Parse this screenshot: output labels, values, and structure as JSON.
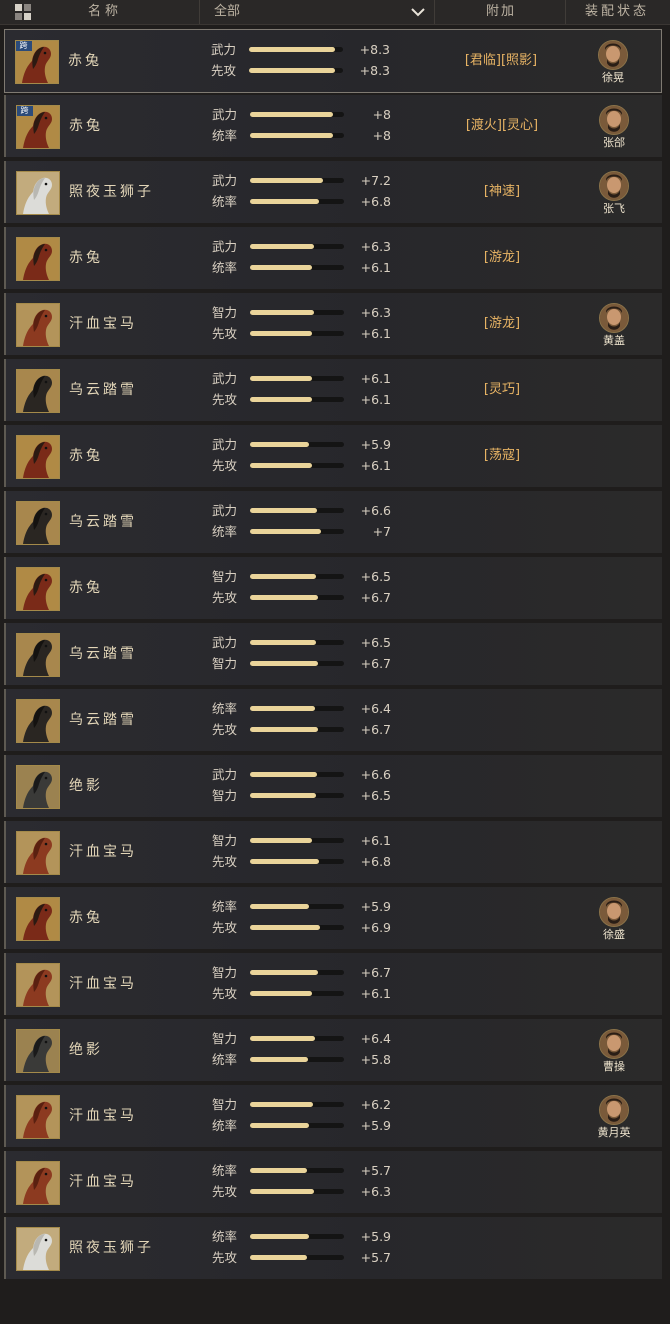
{
  "header": {
    "name_col": "名称",
    "filter_value": "全部",
    "extra_col": "附加",
    "status_col": "装配状态",
    "layout_icon": "grid-layout-icon",
    "filter_icon": "chevron-down-icon"
  },
  "colors": {
    "bar_fill": "#ead49a",
    "bar_track": "#141414",
    "extra_text": "#e7b364",
    "row_bg": "#2b2b30"
  },
  "horses": [
    {
      "name": "赤兔",
      "portrait": "red-horse-icon",
      "cross_server": true,
      "cross_label": "跨",
      "selected": true,
      "stats": [
        {
          "label": "武力",
          "value": "+8.3",
          "bar": 0.92
        },
        {
          "label": "先攻",
          "value": "+8.3",
          "bar": 0.92
        }
      ],
      "extra": "[君临][照影]",
      "equipped_by": "徐晃",
      "avatar": "general-avatar-icon"
    },
    {
      "name": "赤兔",
      "portrait": "red-horse-icon",
      "cross_server": true,
      "cross_label": "跨",
      "selected": false,
      "stats": [
        {
          "label": "武力",
          "value": "+8",
          "bar": 0.88
        },
        {
          "label": "统率",
          "value": "+8",
          "bar": 0.88
        }
      ],
      "extra": "[渡火][灵心]",
      "equipped_by": "张郃",
      "avatar": "general-avatar-icon"
    },
    {
      "name": "照夜玉狮子",
      "portrait": "white-horse-icon",
      "cross_server": false,
      "selected": false,
      "stats": [
        {
          "label": "武力",
          "value": "+7.2",
          "bar": 0.78
        },
        {
          "label": "统率",
          "value": "+6.8",
          "bar": 0.73
        }
      ],
      "extra": "[神速]",
      "equipped_by": "张飞",
      "avatar": "general-avatar-icon"
    },
    {
      "name": "赤兔",
      "portrait": "red-horse-icon",
      "cross_server": false,
      "selected": false,
      "stats": [
        {
          "label": "武力",
          "value": "+6.3",
          "bar": 0.68
        },
        {
          "label": "统率",
          "value": "+6.1",
          "bar": 0.66
        }
      ],
      "extra": "[游龙]",
      "equipped_by": "",
      "avatar": ""
    },
    {
      "name": "汗血宝马",
      "portrait": "chestnut-horse-icon",
      "cross_server": false,
      "selected": false,
      "stats": [
        {
          "label": "智力",
          "value": "+6.3",
          "bar": 0.68
        },
        {
          "label": "先攻",
          "value": "+6.1",
          "bar": 0.66
        }
      ],
      "extra": "[游龙]",
      "equipped_by": "黄盖",
      "avatar": "general-avatar-icon"
    },
    {
      "name": "乌云踏雪",
      "portrait": "black-horse-icon",
      "cross_server": false,
      "selected": false,
      "stats": [
        {
          "label": "武力",
          "value": "+6.1",
          "bar": 0.66
        },
        {
          "label": "先攻",
          "value": "+6.1",
          "bar": 0.66
        }
      ],
      "extra": "[灵巧]",
      "equipped_by": "",
      "avatar": ""
    },
    {
      "name": "赤兔",
      "portrait": "red-horse-icon",
      "cross_server": false,
      "selected": false,
      "stats": [
        {
          "label": "武力",
          "value": "+5.9",
          "bar": 0.63
        },
        {
          "label": "先攻",
          "value": "+6.1",
          "bar": 0.66
        }
      ],
      "extra": "[荡寇]",
      "equipped_by": "",
      "avatar": ""
    },
    {
      "name": "乌云踏雪",
      "portrait": "black-horse-icon",
      "cross_server": false,
      "selected": false,
      "stats": [
        {
          "label": "武力",
          "value": "+6.6",
          "bar": 0.71
        },
        {
          "label": "统率",
          "value": "+7",
          "bar": 0.75
        }
      ],
      "extra": "",
      "equipped_by": "",
      "avatar": ""
    },
    {
      "name": "赤兔",
      "portrait": "red-horse-icon",
      "cross_server": false,
      "selected": false,
      "stats": [
        {
          "label": "智力",
          "value": "+6.5",
          "bar": 0.7
        },
        {
          "label": "先攻",
          "value": "+6.7",
          "bar": 0.72
        }
      ],
      "extra": "",
      "equipped_by": "",
      "avatar": ""
    },
    {
      "name": "乌云踏雪",
      "portrait": "black-horse-icon",
      "cross_server": false,
      "selected": false,
      "stats": [
        {
          "label": "武力",
          "value": "+6.5",
          "bar": 0.7
        },
        {
          "label": "智力",
          "value": "+6.7",
          "bar": 0.72
        }
      ],
      "extra": "",
      "equipped_by": "",
      "avatar": ""
    },
    {
      "name": "乌云踏雪",
      "portrait": "black-horse-icon",
      "cross_server": false,
      "selected": false,
      "stats": [
        {
          "label": "统率",
          "value": "+6.4",
          "bar": 0.69
        },
        {
          "label": "先攻",
          "value": "+6.7",
          "bar": 0.72
        }
      ],
      "extra": "",
      "equipped_by": "",
      "avatar": ""
    },
    {
      "name": "绝影",
      "portrait": "dark-horse-icon",
      "cross_server": false,
      "selected": false,
      "stats": [
        {
          "label": "武力",
          "value": "+6.6",
          "bar": 0.71
        },
        {
          "label": "智力",
          "value": "+6.5",
          "bar": 0.7
        }
      ],
      "extra": "",
      "equipped_by": "",
      "avatar": ""
    },
    {
      "name": "汗血宝马",
      "portrait": "chestnut-horse-icon",
      "cross_server": false,
      "selected": false,
      "stats": [
        {
          "label": "智力",
          "value": "+6.1",
          "bar": 0.66
        },
        {
          "label": "先攻",
          "value": "+6.8",
          "bar": 0.73
        }
      ],
      "extra": "",
      "equipped_by": "",
      "avatar": ""
    },
    {
      "name": "赤兔",
      "portrait": "red-horse-icon",
      "cross_server": false,
      "selected": false,
      "stats": [
        {
          "label": "统率",
          "value": "+5.9",
          "bar": 0.63
        },
        {
          "label": "先攻",
          "value": "+6.9",
          "bar": 0.74
        }
      ],
      "extra": "",
      "equipped_by": "徐盛",
      "avatar": "general-avatar-icon"
    },
    {
      "name": "汗血宝马",
      "portrait": "chestnut-horse-icon",
      "cross_server": false,
      "selected": false,
      "stats": [
        {
          "label": "智力",
          "value": "+6.7",
          "bar": 0.72
        },
        {
          "label": "先攻",
          "value": "+6.1",
          "bar": 0.66
        }
      ],
      "extra": "",
      "equipped_by": "",
      "avatar": ""
    },
    {
      "name": "绝影",
      "portrait": "dark-horse-icon",
      "cross_server": false,
      "selected": false,
      "stats": [
        {
          "label": "智力",
          "value": "+6.4",
          "bar": 0.69
        },
        {
          "label": "统率",
          "value": "+5.8",
          "bar": 0.62
        }
      ],
      "extra": "",
      "equipped_by": "曹操",
      "avatar": "general-avatar-icon"
    },
    {
      "name": "汗血宝马",
      "portrait": "chestnut-horse-icon",
      "cross_server": false,
      "selected": false,
      "stats": [
        {
          "label": "智力",
          "value": "+6.2",
          "bar": 0.67
        },
        {
          "label": "统率",
          "value": "+5.9",
          "bar": 0.63
        }
      ],
      "extra": "",
      "equipped_by": "黄月英",
      "avatar": "general-avatar-icon"
    },
    {
      "name": "汗血宝马",
      "portrait": "chestnut-horse-icon",
      "cross_server": false,
      "selected": false,
      "stats": [
        {
          "label": "统率",
          "value": "+5.7",
          "bar": 0.61
        },
        {
          "label": "先攻",
          "value": "+6.3",
          "bar": 0.68
        }
      ],
      "extra": "",
      "equipped_by": "",
      "avatar": ""
    },
    {
      "name": "照夜玉狮子",
      "portrait": "white-horse-icon",
      "cross_server": false,
      "selected": false,
      "stats": [
        {
          "label": "统率",
          "value": "+5.9",
          "bar": 0.63
        },
        {
          "label": "先攻",
          "value": "+5.7",
          "bar": 0.61
        }
      ],
      "extra": "",
      "equipped_by": "",
      "avatar": ""
    }
  ]
}
